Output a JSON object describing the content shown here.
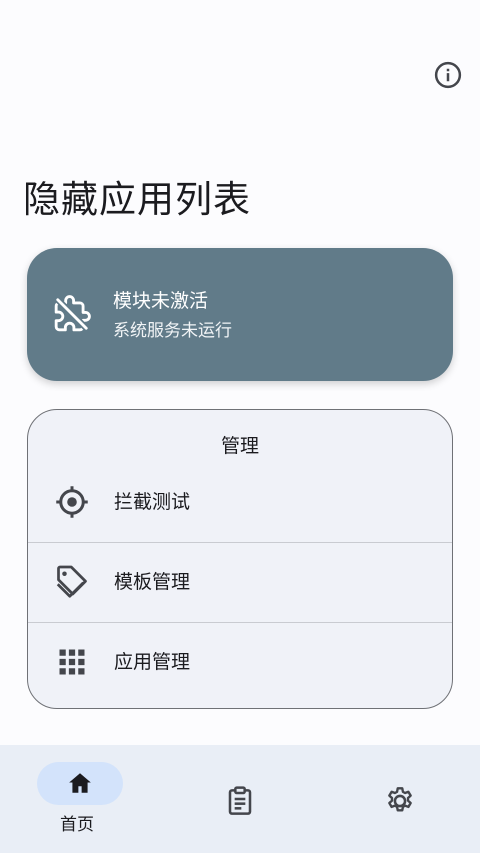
{
  "page": {
    "title": "隐藏应用列表"
  },
  "toolbar": {
    "info_icon": "info-icon"
  },
  "status_card": {
    "title": "模块未激活",
    "subtitle": "系统服务未运行",
    "icon": "extension-off-icon",
    "color": "#617b89"
  },
  "manage": {
    "header": "管理",
    "items": [
      {
        "label": "拦截测试",
        "icon": "target-icon"
      },
      {
        "label": "模板管理",
        "icon": "tag-icon"
      },
      {
        "label": "应用管理",
        "icon": "apps-grid-icon"
      }
    ]
  },
  "bottom_nav": {
    "items": [
      {
        "label": "首页",
        "icon": "home-icon",
        "selected": true
      },
      {
        "label": "",
        "icon": "clipboard-icon",
        "selected": false
      },
      {
        "label": "",
        "icon": "settings-icon",
        "selected": false
      }
    ],
    "selected_color": "#d3e3fb"
  }
}
